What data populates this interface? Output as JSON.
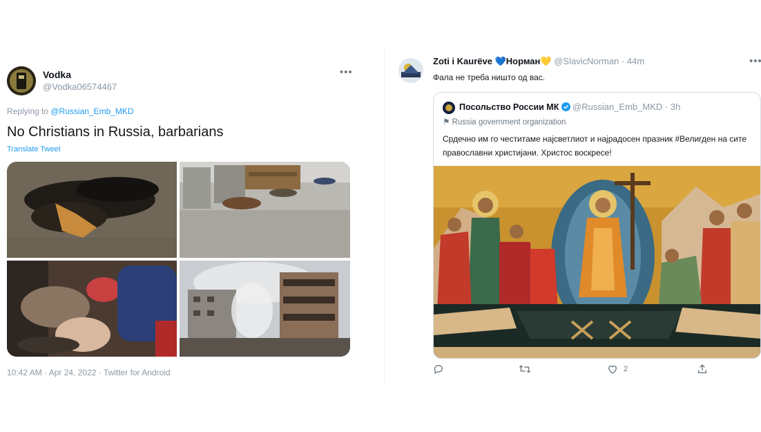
{
  "left_tweet": {
    "author_name": "Vodka",
    "author_handle": "@Vodka06574467",
    "replying_prefix": "Replying to ",
    "replying_handle": "@Russian_Emb_MKD",
    "text": "No Christians in Russia, barbarians",
    "translate_label": "Translate Tweet",
    "timestamp": "10:42 AM · Apr 24, 2022 · Twitter for Android",
    "more_icon": "more-horizontal-icon",
    "media": [
      "photo-burned-body",
      "photo-bodies-on-street",
      "photo-bodies-indoors",
      "photo-destroyed-building"
    ]
  },
  "right_tweet": {
    "author_name": "Zoti i Kaurëve 💙Норман💛",
    "author_handle": "@SlavicNorman",
    "time": " · 44m",
    "text": "Фала не треба ништо од вас.",
    "more_icon": "more-horizontal-icon",
    "quote": {
      "author_name": "Посольство России МК",
      "author_handle": "@Russian_Emb_MKD",
      "time": " · 3h",
      "org_label": "Russia government organization",
      "text": "Срдечно им го честитаме најсветлиот и најрадосен празник #Велигден на сите православни христијани. Христос воскресе!",
      "image": "photo-easter-icon"
    },
    "actions": {
      "reply_icon": "reply-icon",
      "retweet_icon": "retweet-icon",
      "like_icon": "like-icon",
      "like_count": "2",
      "share_icon": "share-icon"
    }
  },
  "colors": {
    "link": "#1d9bf0",
    "secondary_text": "#8b98a5",
    "verified": "#1d9bf0"
  }
}
